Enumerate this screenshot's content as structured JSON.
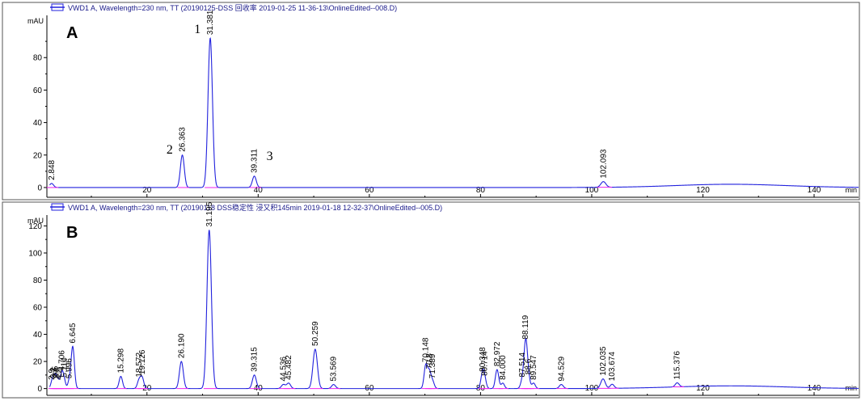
{
  "figure": {
    "colors": {
      "trace": "#2222dd",
      "baseline": "#ee22ee",
      "frame": "#000000",
      "header_marker": "#2222dd"
    }
  },
  "chart_data": [
    {
      "type": "line",
      "panel_label": "A",
      "header": "VWD1 A, Wavelength=230 nm, TT (20190125-DSS 回收率 2019-01-25 11-36-13\\OnlineEdited--008.D)",
      "ylabel": "mAU",
      "xlabel": "min",
      "xlim": [
        2,
        148
      ],
      "ylim": [
        -6,
        106
      ],
      "x_ticks": [
        20,
        40,
        60,
        80,
        100,
        120,
        140
      ],
      "x_tick_labels": [
        "20",
        "40",
        "60",
        "80",
        "100",
        "120",
        "140"
      ],
      "y_ticks": [
        0,
        20,
        40,
        60,
        80
      ],
      "y_tick_labels": [
        "0",
        "20",
        "40",
        "60",
        "80"
      ],
      "peaks": [
        {
          "rt": 2.848,
          "label": "2.848",
          "height": 2.5,
          "width": 0.35
        },
        {
          "rt": 26.363,
          "label": "26.363",
          "height": 20,
          "width": 0.35
        },
        {
          "rt": 31.381,
          "label": "31.381",
          "height": 92,
          "width": 0.4
        },
        {
          "rt": 39.311,
          "label": "39.311",
          "height": 7,
          "width": 0.35
        },
        {
          "rt": 102.093,
          "label": "102.093",
          "height": 3.5,
          "width": 0.45
        }
      ],
      "annotations": [
        {
          "text": "1",
          "x": 28.5,
          "y": 95
        },
        {
          "text": "2",
          "x": 23.5,
          "y": 21
        },
        {
          "text": "3",
          "x": 41.5,
          "y": 17
        }
      ]
    },
    {
      "type": "line",
      "panel_label": "B",
      "header": "VWD1 A, Wavelength=230 nm, TT (20190118 DSS稳定性 浸又积145min 2019-01-18 12-32-37\\OnlineEdited--005.D)",
      "ylabel": "mAU",
      "xlabel": "min",
      "xlim": [
        2,
        148
      ],
      "ylim": [
        -5,
        128
      ],
      "x_ticks": [
        20,
        40,
        60,
        80,
        100,
        120,
        140
      ],
      "x_tick_labels": [
        "20",
        "40",
        "60",
        "80",
        "100",
        "120",
        "140"
      ],
      "y_ticks": [
        0,
        20,
        40,
        60,
        80,
        100,
        120
      ],
      "y_tick_labels": [
        "0",
        "20",
        "40",
        "60",
        "80",
        "100",
        "120"
      ],
      "peaks": [
        {
          "rt": 2.9,
          "label": "2.9",
          "height": 4,
          "width": 0.25
        },
        {
          "rt": 3.2,
          "label": "3.2",
          "height": 5,
          "width": 0.25
        },
        {
          "rt": 3.5,
          "label": "3.5",
          "height": 6,
          "width": 0.25
        },
        {
          "rt": 3.8,
          "label": "3.8",
          "height": 5,
          "width": 0.25
        },
        {
          "rt": 4.2,
          "label": "4.2",
          "height": 4,
          "width": 0.25
        },
        {
          "rt": 4.706,
          "label": "4.706",
          "height": 11,
          "width": 0.25
        },
        {
          "rt": 5.114,
          "label": "5.114",
          "height": 6,
          "width": 0.25
        },
        {
          "rt": 5.996,
          "label": "5.996",
          "height": 5,
          "width": 0.25
        },
        {
          "rt": 6.645,
          "label": "6.645",
          "height": 31,
          "width": 0.3
        },
        {
          "rt": 15.298,
          "label": "15.298",
          "height": 9,
          "width": 0.3
        },
        {
          "rt": 18.572,
          "label": "18.572",
          "height": 6,
          "width": 0.3
        },
        {
          "rt": 19.126,
          "label": "19.126",
          "height": 8,
          "width": 0.3
        },
        {
          "rt": 26.19,
          "label": "26.190",
          "height": 20,
          "width": 0.35
        },
        {
          "rt": 31.195,
          "label": "31.195",
          "height": 117,
          "width": 0.4
        },
        {
          "rt": 39.315,
          "label": "39.315",
          "height": 10,
          "width": 0.35
        },
        {
          "rt": 44.536,
          "label": "44.536",
          "height": 3,
          "width": 0.35
        },
        {
          "rt": 45.482,
          "label": "45.482",
          "height": 4,
          "width": 0.35
        },
        {
          "rt": 50.259,
          "label": "50.259",
          "height": 29,
          "width": 0.4
        },
        {
          "rt": 53.569,
          "label": "53.569",
          "height": 3,
          "width": 0.35
        },
        {
          "rt": 70.148,
          "label": "70.148",
          "height": 17,
          "width": 0.3
        },
        {
          "rt": 70.8,
          "label": "70.8",
          "height": 12,
          "width": 0.3
        },
        {
          "rt": 71.389,
          "label": "71.389",
          "height": 5,
          "width": 0.3
        },
        {
          "rt": 80.348,
          "label": "80.348",
          "height": 10,
          "width": 0.3
        },
        {
          "rt": 80.714,
          "label": "80.714",
          "height": 7,
          "width": 0.3
        },
        {
          "rt": 82.972,
          "label": "82.972",
          "height": 14,
          "width": 0.3
        },
        {
          "rt": 84.0,
          "label": "84.000",
          "height": 4,
          "width": 0.3
        },
        {
          "rt": 87.514,
          "label": "87.514",
          "height": 6,
          "width": 0.3
        },
        {
          "rt": 88.119,
          "label": "88.119",
          "height": 34,
          "width": 0.3
        },
        {
          "rt": 88.6,
          "label": "88.6",
          "height": 8,
          "width": 0.3
        },
        {
          "rt": 89.547,
          "label": "89.547",
          "height": 4,
          "width": 0.3
        },
        {
          "rt": 94.529,
          "label": "94.529",
          "height": 3,
          "width": 0.35
        },
        {
          "rt": 102.035,
          "label": "102.035",
          "height": 7,
          "width": 0.4
        },
        {
          "rt": 103.674,
          "label": "103.674",
          "height": 3,
          "width": 0.35
        },
        {
          "rt": 115.376,
          "label": "115.376",
          "height": 3,
          "width": 0.35
        }
      ]
    }
  ]
}
